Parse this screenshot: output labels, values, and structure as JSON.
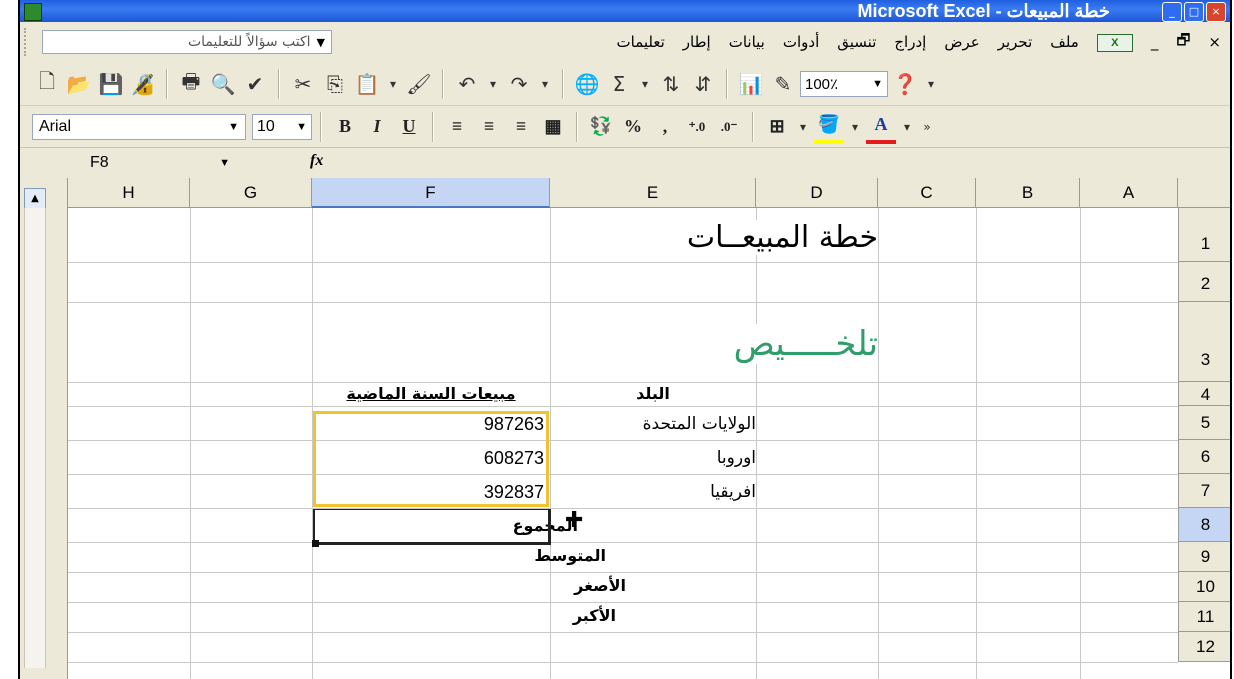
{
  "window": {
    "title": "Microsoft Excel - خطة المبيعات",
    "buttons": [
      "_",
      "□",
      "×"
    ]
  },
  "menubar": {
    "items": [
      "ملف",
      "تحرير",
      "عرض",
      "إدراج",
      "تنسيق",
      "أدوات",
      "بيانات",
      "إطار",
      "تعليمات"
    ],
    "ask_placeholder": "اكتب سؤالاً للتعليمات",
    "close_label": "×",
    "restore_label": "🗗",
    "minimize_label": "_"
  },
  "toolbar": {
    "zoom": "100٪"
  },
  "formatbar": {
    "font": "Arial",
    "size": "10",
    "bold": "B",
    "italic": "I",
    "underline": "U",
    "percent": "%",
    "comma": ",",
    "font_color": "A"
  },
  "formula": {
    "name_box": "F8",
    "fx": "fx",
    "content": ""
  },
  "columns": [
    "A",
    "B",
    "C",
    "D",
    "E",
    "F",
    "G",
    "H"
  ],
  "rows": [
    "1",
    "2",
    "3",
    "4",
    "5",
    "6",
    "7",
    "8",
    "9",
    "10",
    "11",
    "12"
  ],
  "sheet": {
    "title": "خطة المبيعــات",
    "subtitle": "تلخـــــيص",
    "header_country": "البلد",
    "header_sales": "مبيعات السنة الماضية",
    "countries": [
      "الولايات المتحدة",
      "اوروبا",
      "افريقيا"
    ],
    "values": [
      "987263",
      "608273",
      "392837"
    ],
    "stats": [
      "المجموع",
      "المتوسط",
      "الأصغر",
      "الأكبر"
    ]
  },
  "colors": {
    "subtitle": "#2e9e6a",
    "selection": "#f2c230",
    "titlebar": "#2a66e6"
  }
}
